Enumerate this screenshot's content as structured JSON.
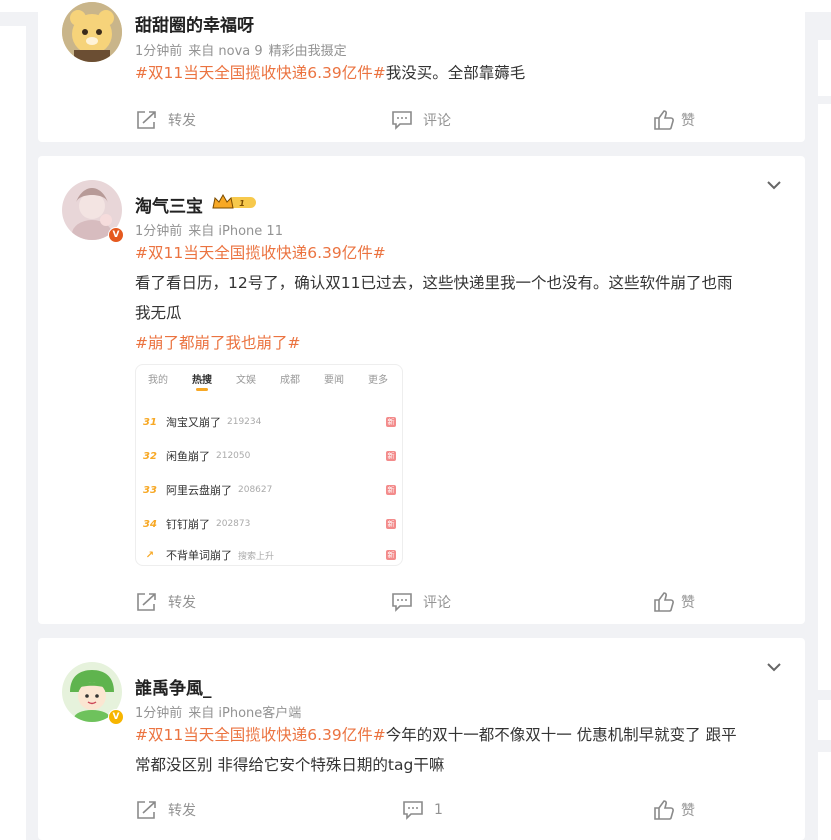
{
  "posts": [
    {
      "author": "甜甜圈的幸福呀",
      "time": "1分钟前",
      "source": "来自 nova 9",
      "extra": "精彩由我摄定",
      "topic": "#双11当天全国揽收快递6.39亿件#",
      "body": "我没买。全部靠薅毛",
      "actions": {
        "repost": "转发",
        "comment": "评论",
        "like": "赞"
      }
    },
    {
      "author": "淘气三宝",
      "time": "1分钟前",
      "source": "来自 iPhone 11",
      "topic": "#双11当天全国揽收快递6.39亿件#",
      "body_line1": "看了看日历，12号了，确认双11已过去，这些快递里我一个也没有。这些软件崩了也雨",
      "body_line2": "我无瓜",
      "topic2": "#崩了都崩了我也崩了#",
      "screenshot": {
        "tabs": [
          "我的",
          "热搜",
          "文娱",
          "成都",
          "要闻",
          "更多"
        ],
        "active_tab": "热搜",
        "rows": [
          {
            "rank": "31",
            "title": "淘宝又崩了",
            "num": "219234",
            "badge": "新"
          },
          {
            "rank": "32",
            "title": "闲鱼崩了",
            "num": "212050",
            "badge": "新"
          },
          {
            "rank": "33",
            "title": "阿里云盘崩了",
            "num": "208627",
            "badge": "新"
          },
          {
            "rank": "34",
            "title": "钉钉崩了",
            "num": "202873",
            "badge": "新"
          },
          {
            "rank": "↗",
            "title": "不背单词崩了",
            "num": "搜索上升",
            "badge": "新"
          }
        ]
      },
      "actions": {
        "repost": "转发",
        "comment": "评论",
        "like": "赞"
      }
    },
    {
      "author": "誰禹争風_",
      "time": "1分钟前",
      "source": "来自 iPhone客户端",
      "topic": "#双11当天全国揽收快递6.39亿件#",
      "body_line1": "今年的双十一都不像双十一 优惠机制早就变了 跟平",
      "body_line2": "常都没区别 非得给它安个特殊日期的tag干嘛",
      "actions": {
        "repost": "转发",
        "comment": "1",
        "like": "赞"
      }
    }
  ],
  "colors": {
    "topic": "#eb7340",
    "meta": "#939393",
    "vip_badge": "#e5591f",
    "verified_badge": "#f7b500"
  },
  "icons": {
    "repost": "share-icon",
    "comment": "comment-icon",
    "like": "thumbs-up-icon",
    "more": "chevron-down-icon"
  }
}
